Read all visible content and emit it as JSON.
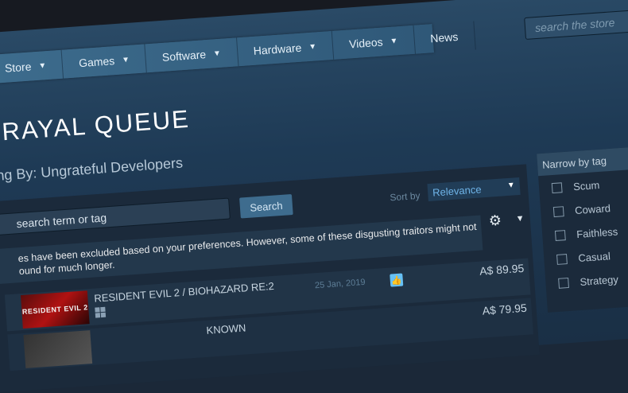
{
  "nav": {
    "items": [
      {
        "label": "Store",
        "dropdown": true
      },
      {
        "label": "Games",
        "dropdown": true
      },
      {
        "label": "Software",
        "dropdown": true
      },
      {
        "label": "Hardware",
        "dropdown": true
      },
      {
        "label": "Videos",
        "dropdown": true
      },
      {
        "label": "News",
        "dropdown": false
      }
    ],
    "search_placeholder": "search the store"
  },
  "page": {
    "title": "TRAYAL QUEUE",
    "subtitle": "ng By: Ungrateful Developers"
  },
  "search": {
    "value": "search term or tag",
    "button_label": "Search",
    "sort_label": "Sort by",
    "sort_value": "Relevance"
  },
  "notice": {
    "line1": "es have been excluded based on your preferences. However, some of these disgusting traitors might not",
    "line2": "ound for much longer."
  },
  "results": [
    {
      "capsule": "RESIDENT EVIL 2",
      "name": "RESIDENT EVIL 2 / BIOHAZARD RE:2",
      "date": "25 Jan, 2019",
      "price": "A$ 89.95",
      "review": "positive"
    },
    {
      "capsule": "",
      "name": "KNOWN",
      "date": "",
      "price": "A$ 79.95",
      "review": ""
    }
  ],
  "sidebar": {
    "heading": "Narrow by tag",
    "tags": [
      "Scum",
      "Coward",
      "Faithless",
      "Casual",
      "Strategy"
    ]
  },
  "colors": {
    "accent": "#66c0f4",
    "nav_bg": "#3d6c8d",
    "page_bg": "#1b2838"
  }
}
